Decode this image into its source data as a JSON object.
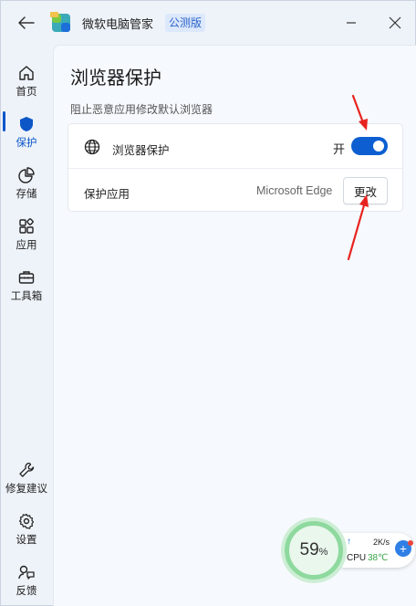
{
  "titlebar": {
    "app_title": "微软电脑管家",
    "edition_badge": "公测版"
  },
  "sidebar": {
    "items": [
      {
        "label": "首页",
        "icon": "home-icon"
      },
      {
        "label": "保护",
        "icon": "shield-icon",
        "active": true
      },
      {
        "label": "存储",
        "icon": "pie-chart-icon"
      },
      {
        "label": "应用",
        "icon": "apps-icon"
      },
      {
        "label": "工具箱",
        "icon": "toolbox-icon"
      }
    ],
    "bottom_items": [
      {
        "label": "修复建议",
        "icon": "wrench-icon"
      },
      {
        "label": "设置",
        "icon": "gear-icon"
      },
      {
        "label": "反馈",
        "icon": "feedback-icon"
      }
    ]
  },
  "main": {
    "title": "浏览器保护",
    "description": "阻止恶意应用修改默认浏览器",
    "browser_protection": {
      "label": "浏览器保护",
      "state_label": "开",
      "enabled": true
    },
    "protected_app": {
      "label": "保护应用",
      "value": "Microsoft Edge",
      "button_label": "更改"
    }
  },
  "widget": {
    "percent": "59",
    "percent_unit": "%",
    "net_arrow": "↑",
    "net_speed": "2K/s",
    "cpu_label": "CPU",
    "cpu_temp": "38℃",
    "plus_label": "+"
  },
  "colors": {
    "accent": "#0d5fd1",
    "annotation_arrow": "#e8231f",
    "widget_ring": "#8ed99e"
  }
}
